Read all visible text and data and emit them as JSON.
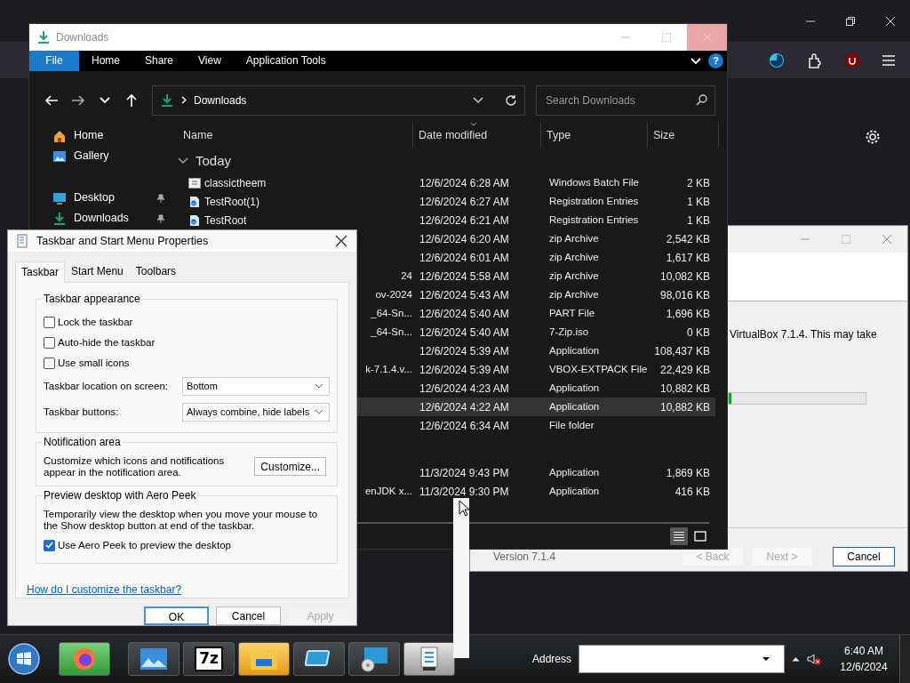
{
  "explorer": {
    "title": "Downloads",
    "ribbon_tabs": [
      {
        "label": "File",
        "selected": true
      },
      {
        "label": "Home",
        "selected": false
      },
      {
        "label": "Share",
        "selected": false
      },
      {
        "label": "View",
        "selected": false
      },
      {
        "label": "Application Tools",
        "selected": false
      }
    ],
    "help": "?",
    "address": "Downloads",
    "search": {
      "placeholder": "Search Downloads"
    },
    "sidebar": [
      {
        "label": "Home",
        "kind": "home",
        "pinned": false
      },
      {
        "label": "Gallery",
        "kind": "gallery",
        "pinned": false
      },
      {
        "label": "Desktop",
        "kind": "desktop",
        "pinned": true
      },
      {
        "label": "Downloads",
        "kind": "downloads",
        "pinned": true
      }
    ],
    "columns": [
      "Name",
      "Date modified",
      "Type",
      "Size"
    ],
    "group": "Today",
    "rows": [
      {
        "kind": "batch",
        "name": "classictheem",
        "date": "12/6/2024 6:28 AM",
        "type": "Windows Batch File",
        "size": "2 KB",
        "selected": false
      },
      {
        "kind": "reg",
        "name": "TestRoot(1)",
        "date": "12/6/2024 6:27 AM",
        "type": "Registration Entries",
        "size": "1 KB",
        "selected": false
      },
      {
        "kind": "reg",
        "name": "TestRoot",
        "date": "12/6/2024 6:21 AM",
        "type": "Registration Entries",
        "size": "1 KB",
        "selected": false
      },
      {
        "kind": "clipped",
        "date": "12/6/2024 6:20 AM",
        "type": "zip Archive",
        "size": "2,542 KB",
        "selected": false
      },
      {
        "kind": "clipped",
        "date": "12/6/2024 6:01 AM",
        "type": "zip Archive",
        "size": "1,617 KB",
        "selected": false
      },
      {
        "kind": "clipped",
        "name": "24",
        "date": "12/6/2024 5:58 AM",
        "type": "zip Archive",
        "size": "10,082 KB",
        "selected": false
      },
      {
        "kind": "clipped",
        "name": "ov-2024",
        "date": "12/6/2024 5:43 AM",
        "type": "zip Archive",
        "size": "98,016 KB",
        "selected": false
      },
      {
        "kind": "clipped",
        "name": "_64-Sn...",
        "date": "12/6/2024 5:40 AM",
        "type": "PART File",
        "size": "1,696 KB",
        "selected": false
      },
      {
        "kind": "clipped",
        "name": "_64-Sn...",
        "date": "12/6/2024 5:40 AM",
        "type": "7-Zip.iso",
        "size": "0 KB",
        "selected": false
      },
      {
        "kind": "clipped",
        "date": "12/6/2024 5:39 AM",
        "type": "Application",
        "size": "108,437 KB",
        "selected": false
      },
      {
        "kind": "clipped",
        "name": "k-7.1.4.v...",
        "date": "12/6/2024 5:39 AM",
        "type": "VBOX-EXTPACK File",
        "size": "22,429 KB",
        "selected": false
      },
      {
        "kind": "clipped",
        "date": "12/6/2024 4:23 AM",
        "type": "Application",
        "size": "10,882 KB",
        "selected": false
      },
      {
        "kind": "clipped",
        "date": "12/6/2024 4:22 AM",
        "type": "Application",
        "size": "10,882 KB",
        "selected": true
      },
      {
        "kind": "clipped",
        "date": "12/6/2024 6:34 AM",
        "type": "File folder",
        "selected": false
      },
      {
        "kind": "gap"
      },
      {
        "kind": "clipped",
        "date": "11/3/2024 9:43 PM",
        "type": "Application",
        "size": "1,869 KB",
        "selected": false
      },
      {
        "kind": "clipped",
        "name": "enJDK x...",
        "date": "11/3/2024 9:30 PM",
        "type": "Application",
        "size": "416 KB",
        "selected": false
      }
    ]
  },
  "installer": {
    "text": "VirtualBox 7.1.4. This may take",
    "progress": {
      "level": 0.02
    },
    "version": "Version 7.1.4",
    "buttons": [
      {
        "label": "< Back",
        "disabled": true
      },
      {
        "label": "Next >",
        "disabled": true
      },
      {
        "label": "Cancel",
        "disabled": false
      }
    ]
  },
  "dialog": {
    "title": "Taskbar and Start Menu Properties",
    "tabs": [
      {
        "label": "Taskbar",
        "selected": true
      },
      {
        "label": "Start Menu",
        "selected": false
      },
      {
        "label": "Toolbars",
        "selected": false
      }
    ],
    "appearance": {
      "legend": "Taskbar appearance",
      "options": [
        {
          "label": "Lock the taskbar",
          "checked": false
        },
        {
          "label": "Auto-hide the taskbar",
          "checked": false
        },
        {
          "label": "Use small icons",
          "checked": false
        }
      ],
      "selects": [
        {
          "label": "Taskbar location on screen:",
          "value": "Bottom"
        },
        {
          "label": "Taskbar buttons:",
          "value": "Always combine, hide labels"
        }
      ]
    },
    "notification": {
      "legend": "Notification area",
      "text": "Customize which icons and notifications appear in the notification area.",
      "button": "Customize..."
    },
    "peek": {
      "legend": "Preview desktop with Aero Peek",
      "text": "Temporarily view the desktop when you move your mouse to the Show desktop button at end of the taskbar.",
      "option": {
        "label": "Use Aero Peek to preview the desktop",
        "checked": true
      }
    },
    "help_link": "How do I customize the taskbar?",
    "buttons": [
      {
        "label": "OK",
        "default": true,
        "disabled": false
      },
      {
        "label": "Cancel",
        "default": false,
        "disabled": false
      },
      {
        "label": "Apply",
        "default": false,
        "disabled": true
      }
    ]
  },
  "taskbar": {
    "apps": [
      {
        "kind": "firefox"
      },
      {
        "kind": "photos"
      },
      {
        "kind": "sevenzip",
        "label": "7z"
      },
      {
        "kind": "folder"
      },
      {
        "kind": "virtualbox"
      },
      {
        "kind": "remote"
      },
      {
        "kind": "settings"
      }
    ],
    "address_label": "Address",
    "time": "6:40 AM",
    "date": "12/6/2024"
  }
}
